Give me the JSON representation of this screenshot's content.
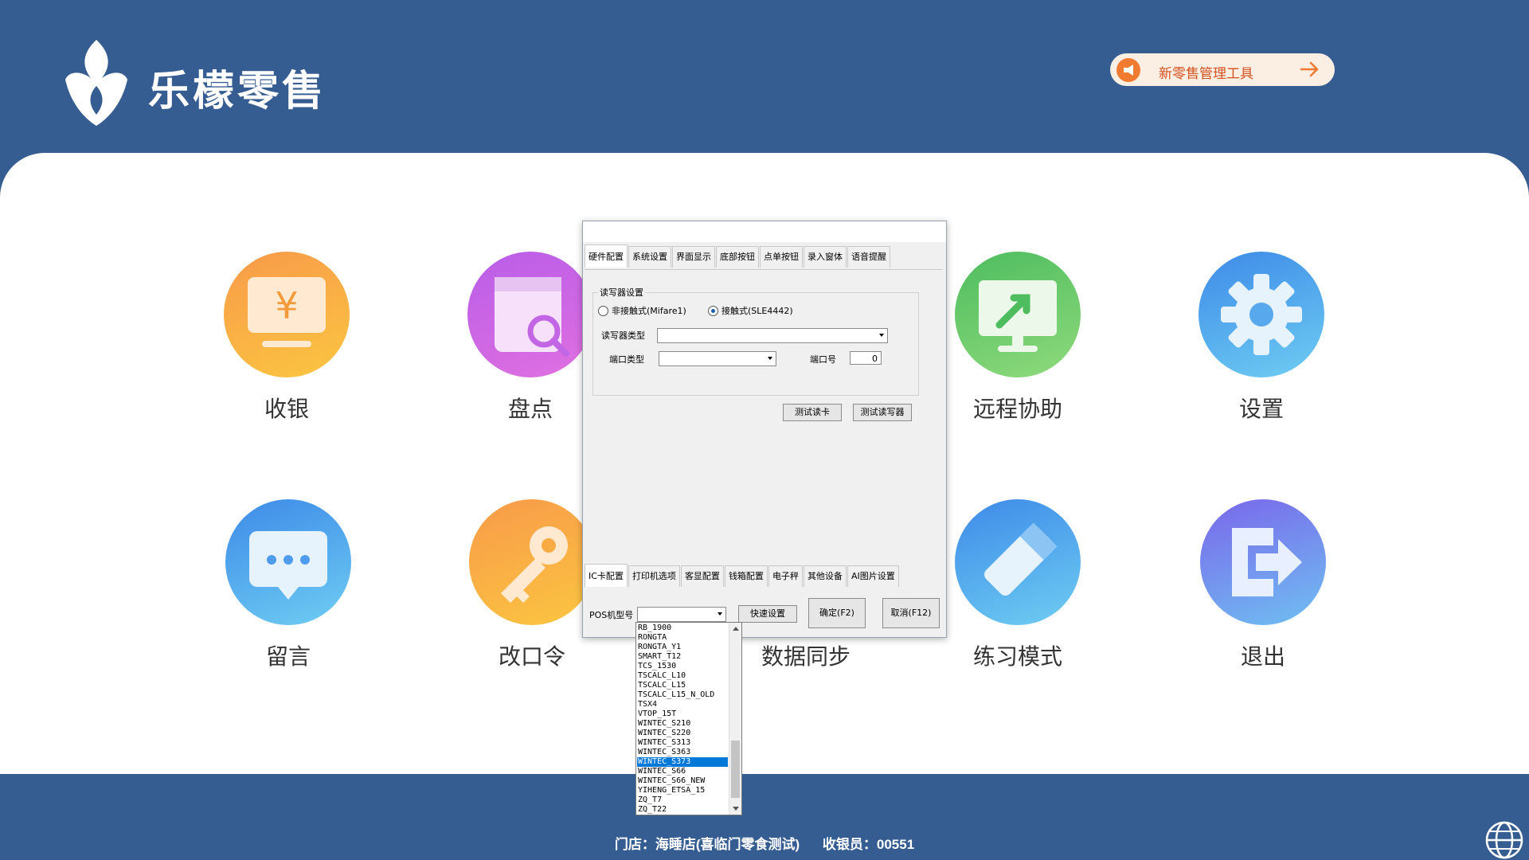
{
  "header": {
    "brand": "乐檬零售",
    "tool_button": "新零售管理工具"
  },
  "tiles": [
    {
      "label": "收银",
      "icon": "cashier-icon"
    },
    {
      "label": "盘点",
      "icon": "inventory-icon"
    },
    {
      "label": "远程协助",
      "icon": "remote-assist-icon"
    },
    {
      "label": "设置",
      "icon": "settings-gear-icon"
    },
    {
      "label": "留言",
      "icon": "message-icon"
    },
    {
      "label": "改口令",
      "icon": "key-icon"
    },
    {
      "label": "数据同步",
      "icon": "sync-icon"
    },
    {
      "label": "练习模式",
      "icon": "eraser-icon"
    },
    {
      "label": "退出",
      "icon": "exit-icon"
    }
  ],
  "footer": {
    "store": "门店：海睡店(喜临门零食测试)",
    "cashier": "收银员：00551"
  },
  "dialog": {
    "top_tabs": [
      "硬件配置",
      "系统设置",
      "界面显示",
      "底部按钮",
      "点单按钮",
      "录入窗体",
      "语音提醒"
    ],
    "group_title": "读写器设置",
    "radio_contactless": "非接触式(Mifare1)",
    "radio_contact": "接触式(SLE4442)",
    "reader_type_label": "读写器类型",
    "port_type_label": "端口类型",
    "port_no_label": "端口号",
    "port_no_value": "0",
    "btn_test_card": "测试读卡",
    "btn_test_reader": "测试读写器",
    "bottom_tabs": [
      "IC卡配置",
      "打印机选项",
      "客显配置",
      "钱箱配置",
      "电子秤",
      "其他设备",
      "AI图片设置"
    ],
    "pos_model_label": "POS机型号",
    "btn_quick": "快速设置",
    "btn_ok": "确定(F2)",
    "btn_cancel": "取消(F12)"
  },
  "dropdown_items": [
    "RB_1900",
    "RONGTA",
    "RONGTA_Y1",
    "SMART_T12",
    "TCS_1530",
    "TSCALC_L10",
    "TSCALC_L15",
    "TSCALC_L15_N_OLD",
    "TSX4",
    "VTOP_15T",
    "WINTEC_S210",
    "WINTEC_S220",
    "WINTEC_S313",
    "WINTEC_S363",
    "WINTEC_S373",
    "WINTEC_S66",
    "WINTEC_S66_NEW",
    "YIHENG_ETSA_15",
    "ZQ_T7",
    "ZQ_T22"
  ],
  "selected_index": 14
}
